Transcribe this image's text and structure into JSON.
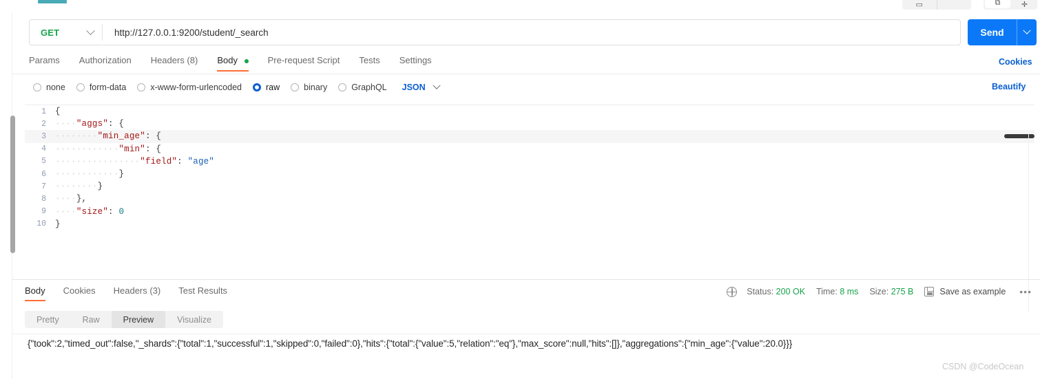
{
  "toolbar": {
    "tab_stub": "",
    "group1_buttons": [
      "layout-icon",
      "panel-icon"
    ],
    "group2_buttons": [
      "copy-icon",
      "plus-icon"
    ]
  },
  "request": {
    "method": "GET",
    "method_caret": "chevron-down-icon",
    "url": "http://127.0.0.1:9200/student/_search",
    "send_label": "Send",
    "send_caret": "chevron-down-icon",
    "tabs": [
      {
        "label": "Params",
        "active": false,
        "dot": false
      },
      {
        "label": "Authorization",
        "active": false,
        "dot": false
      },
      {
        "label": "Headers (8)",
        "active": false,
        "dot": false
      },
      {
        "label": "Body",
        "active": true,
        "dot": true
      },
      {
        "label": "Pre-request Script",
        "active": false,
        "dot": false
      },
      {
        "label": "Tests",
        "active": false,
        "dot": false
      },
      {
        "label": "Settings",
        "active": false,
        "dot": false
      }
    ],
    "cookies_link": "Cookies",
    "beautify_link": "Beautify",
    "body_types": [
      {
        "label": "none",
        "selected": false
      },
      {
        "label": "form-data",
        "selected": false
      },
      {
        "label": "x-www-form-urlencoded",
        "selected": false
      },
      {
        "label": "raw",
        "selected": true
      },
      {
        "label": "binary",
        "selected": false
      },
      {
        "label": "GraphQL",
        "selected": false
      }
    ],
    "format": "JSON",
    "format_caret": "chevron-down-icon",
    "code_lines": [
      {
        "num": "1",
        "indent": 0,
        "guides": 0,
        "highlight": false,
        "tokens": [
          {
            "t": "{",
            "c": "p"
          }
        ]
      },
      {
        "num": "2",
        "indent": 1,
        "guides": 1,
        "highlight": false,
        "tokens": [
          {
            "t": "\"aggs\"",
            "c": "k"
          },
          {
            "t": ":",
            "c": "p"
          },
          {
            "t": " {",
            "c": "p"
          }
        ]
      },
      {
        "num": "3",
        "indent": 2,
        "guides": 2,
        "highlight": true,
        "tokens": [
          {
            "t": "\"min_age\"",
            "c": "k"
          },
          {
            "t": ":",
            "c": "p"
          },
          {
            "t": " {",
            "c": "p"
          }
        ]
      },
      {
        "num": "4",
        "indent": 3,
        "guides": 3,
        "highlight": false,
        "tokens": [
          {
            "t": "\"min\"",
            "c": "k"
          },
          {
            "t": ":",
            "c": "p"
          },
          {
            "t": " {",
            "c": "p"
          }
        ]
      },
      {
        "num": "5",
        "indent": 4,
        "guides": 4,
        "highlight": false,
        "tokens": [
          {
            "t": "\"field\"",
            "c": "k"
          },
          {
            "t": ":",
            "c": "p"
          },
          {
            "t": " ",
            "c": "p"
          },
          {
            "t": "\"age\"",
            "c": "s"
          }
        ]
      },
      {
        "num": "6",
        "indent": 3,
        "guides": 3,
        "highlight": false,
        "tokens": [
          {
            "t": "}",
            "c": "p"
          }
        ]
      },
      {
        "num": "7",
        "indent": 2,
        "guides": 2,
        "highlight": false,
        "tokens": [
          {
            "t": "}",
            "c": "p"
          }
        ]
      },
      {
        "num": "8",
        "indent": 1,
        "guides": 1,
        "highlight": false,
        "tokens": [
          {
            "t": "},",
            "c": "p"
          }
        ]
      },
      {
        "num": "9",
        "indent": 1,
        "guides": 1,
        "highlight": false,
        "tokens": [
          {
            "t": "\"size\"",
            "c": "k"
          },
          {
            "t": ":",
            "c": "p"
          },
          {
            "t": " ",
            "c": "p"
          },
          {
            "t": "0",
            "c": "n"
          }
        ]
      },
      {
        "num": "10",
        "indent": 0,
        "guides": 0,
        "highlight": false,
        "tokens": [
          {
            "t": "}",
            "c": "p"
          }
        ]
      }
    ]
  },
  "response": {
    "tabs": [
      {
        "label": "Body",
        "active": true
      },
      {
        "label": "Cookies",
        "active": false
      },
      {
        "label": "Headers (3)",
        "active": false
      },
      {
        "label": "Test Results",
        "active": false
      }
    ],
    "status_icon": "globe-icon",
    "status_label": "Status:",
    "status_value": "200 OK",
    "time_label": "Time:",
    "time_value": "8 ms",
    "size_label": "Size:",
    "size_value": "275 B",
    "save_icon": "floppy-disk-icon",
    "save_label": "Save as example",
    "more_icon": "ellipsis-icon",
    "view_modes": [
      {
        "label": "Pretty",
        "active": false
      },
      {
        "label": "Raw",
        "active": false
      },
      {
        "label": "Preview",
        "active": true
      },
      {
        "label": "Visualize",
        "active": false
      }
    ],
    "body_text": "{\"took\":2,\"timed_out\":false,\"_shards\":{\"total\":1,\"successful\":1,\"skipped\":0,\"failed\":0},\"hits\":{\"total\":{\"value\":5,\"relation\":\"eq\"},\"max_score\":null,\"hits\":[]},\"aggregations\":{\"min_age\":{\"value\":20.0}}}"
  },
  "watermark": "CSDN @CodeOcean",
  "colors": {
    "accent_orange": "#ff6c37",
    "send_blue": "#0b79f7",
    "link_blue": "#0b5fd0",
    "method_green": "#16a34a",
    "status_green": "#16a34a"
  }
}
